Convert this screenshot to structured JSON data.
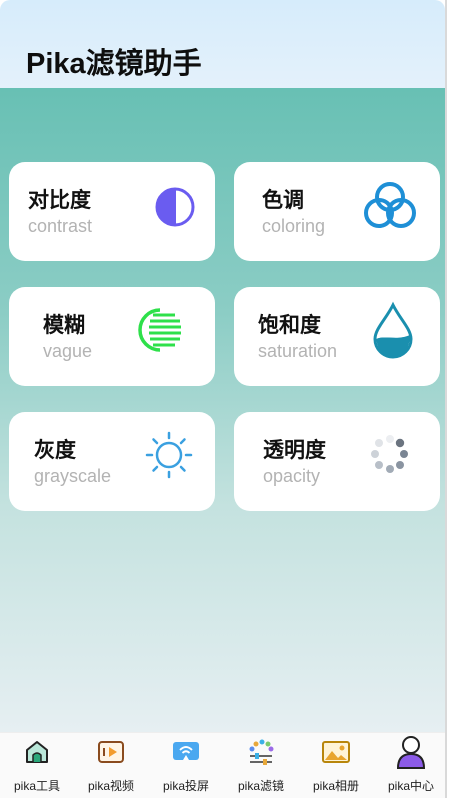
{
  "header": {
    "title": "Pika滤镜助手"
  },
  "cards": [
    {
      "cn": "对比度",
      "en": "contrast",
      "icon": "contrast-half-circle-icon"
    },
    {
      "cn": "色调",
      "en": "coloring",
      "icon": "three-rings-icon"
    },
    {
      "cn": "模糊",
      "en": "vague",
      "icon": "blur-circle-icon"
    },
    {
      "cn": "饱和度",
      "en": "saturation",
      "icon": "water-drop-icon"
    },
    {
      "cn": "灰度",
      "en": "grayscale",
      "icon": "sun-icon"
    },
    {
      "cn": "透明度",
      "en": "opacity",
      "icon": "loading-dots-icon"
    }
  ],
  "tabs": [
    {
      "label": "pika工具",
      "icon": "home-icon"
    },
    {
      "label": "pika视频",
      "icon": "video-icon"
    },
    {
      "label": "pika投屏",
      "icon": "cast-icon"
    },
    {
      "label": "pika滤镜",
      "icon": "filter-icon"
    },
    {
      "label": "pika相册",
      "icon": "gallery-icon"
    },
    {
      "label": "pika中心",
      "icon": "user-icon"
    }
  ],
  "colors": {
    "header_bg": "#d6ecfb",
    "content_top": "#68c0b4",
    "content_bottom": "#e6eff2",
    "contrast_icon": "#6a5cf0",
    "coloring_icon": "#1e8fd6",
    "vague_icon": "#2ee04a",
    "saturation_icon": "#1a8fae",
    "grayscale_icon": "#3aa0e0",
    "opacity_icon": "#7a8593"
  }
}
